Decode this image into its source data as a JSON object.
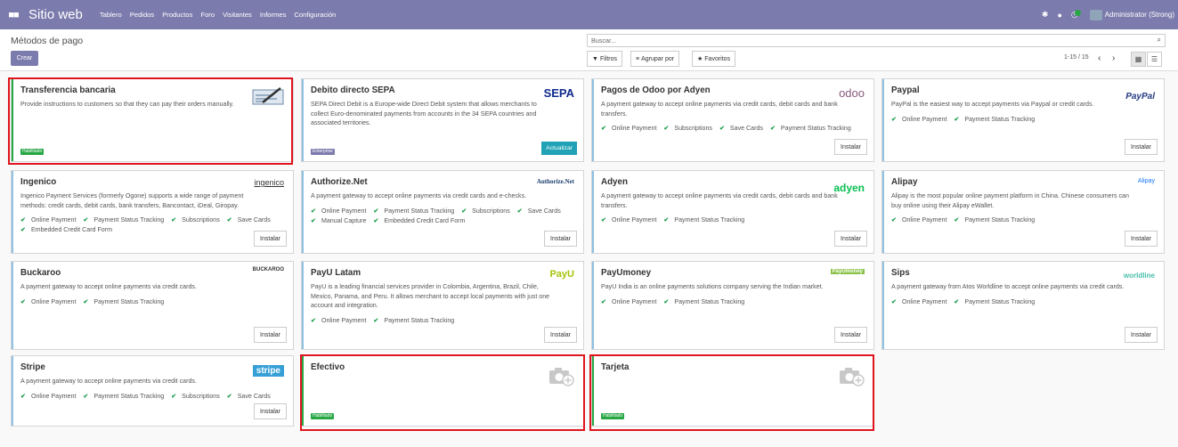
{
  "topbar": {
    "brand": "Sitio web",
    "menu": [
      "Tablero",
      "Pedidos",
      "Productos",
      "Foro",
      "Visitantes",
      "Informes",
      "Configuración"
    ],
    "user": "Administrator (Strong)",
    "icons": [
      "bug-icon",
      "chat-icon",
      "activity-icon"
    ]
  },
  "control": {
    "title": "Métodos de pago",
    "create": "Crear",
    "search_placeholder": "Buscar...",
    "filters": "Filtros",
    "group": "Agrupar por",
    "favorites": "Favoritos",
    "pager": "1-15 / 15"
  },
  "cards": [
    {
      "title": "Transferencia bancaria",
      "desc": "Provide instructions to customers so that they can pay their orders manually.",
      "features": [],
      "state": "Habilitado",
      "logo": "check-icon"
    },
    {
      "title": "Debito directo SEPA",
      "desc": "SEPA Direct Debit is a Europe-wide Direct Debit system that allows merchants to collect Euro-denominated payments from accounts in the 34 SEPA countries and associated territories.",
      "features": [],
      "tag": "Enterprise",
      "action": "Actualizar",
      "logo": "SEPA"
    },
    {
      "title": "Pagos de Odoo por Adyen",
      "desc": "A payment gateway to accept online payments via credit cards, debit cards and bank transfers.",
      "features": [
        "Online Payment",
        "Subscriptions",
        "Save Cards",
        "Payment Status Tracking"
      ],
      "action": "Instalar",
      "logo": "odoo"
    },
    {
      "title": "Paypal",
      "desc": "PayPal is the easiest way to accept payments via Paypal or credit cards.",
      "features": [
        "Online Payment",
        "Payment Status Tracking"
      ],
      "action": "Instalar",
      "logo": "PayPal"
    },
    {
      "title": "Ingenico",
      "desc": "Ingenico Payment Services (formerly Ogone) supports a wide range of payment methods: credit cards, debit cards, bank transfers, Bancontact, iDeal, Giropay.",
      "features": [
        "Online Payment",
        "Payment Status Tracking",
        "Subscriptions",
        "Save Cards",
        "Embedded Credit Card Form"
      ],
      "action": "Instalar",
      "logo": "ingenico"
    },
    {
      "title": "Authorize.Net",
      "desc": "A payment gateway to accept online payments via credit cards and e-checks.",
      "features": [
        "Online Payment",
        "Payment Status Tracking",
        "Subscriptions",
        "Save Cards",
        "Manual Capture",
        "Embedded Credit Card Form"
      ],
      "action": "Instalar",
      "logo": "Authorize.Net"
    },
    {
      "title": "Adyen",
      "desc": "A payment gateway to accept online payments via credit cards, debit cards and bank transfers.",
      "features": [
        "Online Payment",
        "Payment Status Tracking"
      ],
      "action": "Instalar",
      "logo": "adyen"
    },
    {
      "title": "Alipay",
      "desc": "Alipay is the most popular online payment platform in China. Chinese consumers can buy online using their Alipay eWallet.",
      "features": [
        "Online Payment",
        "Payment Status Tracking"
      ],
      "action": "Instalar",
      "logo": "Alipay"
    },
    {
      "title": "Buckaroo",
      "desc": "A payment gateway to accept online payments via credit cards.",
      "features": [
        "Online Payment",
        "Payment Status Tracking"
      ],
      "action": "Instalar",
      "logo": "BUCKAROO"
    },
    {
      "title": "PayU Latam",
      "desc": "PayU is a leading financial services provider in Colombia, Argentina, Brazil, Chile, Mexico, Panama, and Peru. It allows merchant to accept local payments with just one account and integration.",
      "features": [
        "Online Payment",
        "Payment Status Tracking"
      ],
      "action": "Instalar",
      "logo": "PayU"
    },
    {
      "title": "PayUmoney",
      "desc": "PayU India is an online payments solutions company serving the Indian market.",
      "features": [
        "Online Payment",
        "Payment Status Tracking"
      ],
      "action": "Instalar",
      "logo": "PayUmoney"
    },
    {
      "title": "Sips",
      "desc": "A payment gateway from Atos Worldline to accept online payments via credit cards.",
      "features": [
        "Online Payment",
        "Payment Status Tracking"
      ],
      "action": "Instalar",
      "logo": "worldline"
    },
    {
      "title": "Stripe",
      "desc": "A payment gateway to accept online payments via credit cards.",
      "features": [
        "Online Payment",
        "Payment Status Tracking",
        "Subscriptions",
        "Save Cards"
      ],
      "action": "Instalar",
      "logo": "stripe"
    },
    {
      "title": "Efectivo",
      "desc": "",
      "features": [],
      "state": "Habilitado",
      "logo": "camera-icon"
    },
    {
      "title": "Tarjeta",
      "desc": "",
      "features": [],
      "state": "Habilitado",
      "logo": "camera-icon"
    }
  ],
  "colors": {
    "brand": "#7c7bad",
    "accent": "#21a2b6",
    "enabled": "#28a745",
    "highlight": "#e0141e"
  }
}
